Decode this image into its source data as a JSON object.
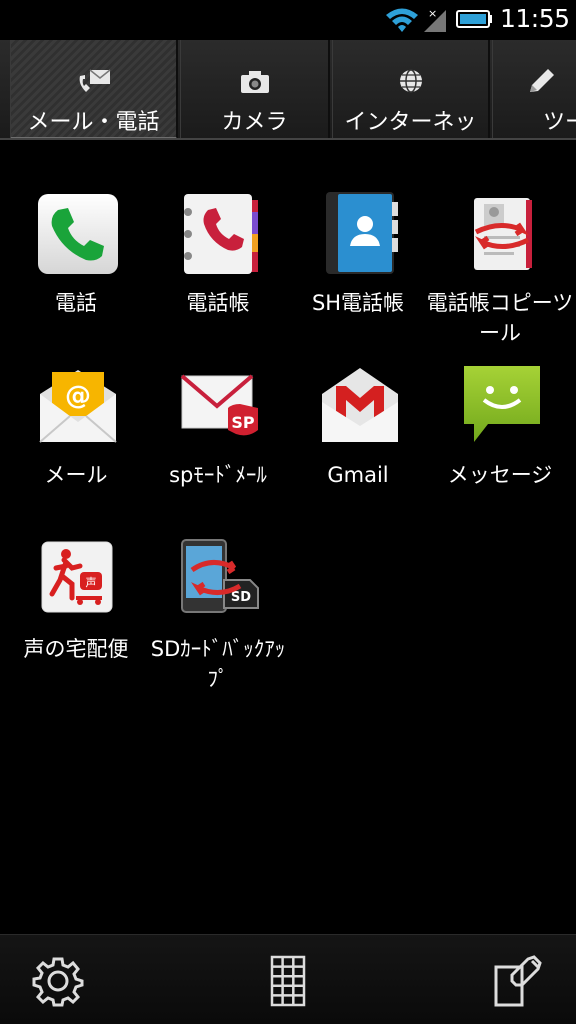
{
  "status": {
    "time": "11:55"
  },
  "tabs": [
    {
      "label": "メール・電話",
      "icon": "mail-phone-icon",
      "active": true
    },
    {
      "label": "カメラ",
      "icon": "camera-icon",
      "active": false
    },
    {
      "label": "インターネッ",
      "icon": "globe-icon",
      "active": false
    },
    {
      "label": "ツー",
      "icon": "pencil-icon",
      "active": false
    }
  ],
  "apps": [
    {
      "label": "電話",
      "icon": "phone-icon"
    },
    {
      "label": "電話帳",
      "icon": "phonebook-icon"
    },
    {
      "label": "SH電話帳",
      "icon": "sh-phonebook-icon"
    },
    {
      "label": "電話帳コピーツール",
      "icon": "phonebook-copy-icon"
    },
    {
      "label": "メール",
      "icon": "mail-icon"
    },
    {
      "label": "spﾓｰﾄﾞﾒｰﾙ",
      "icon": "spmode-mail-icon"
    },
    {
      "label": "Gmail",
      "icon": "gmail-icon"
    },
    {
      "label": "メッセージ",
      "icon": "message-icon"
    },
    {
      "label": "声の宅配便",
      "icon": "voice-delivery-icon"
    },
    {
      "label": "SDｶｰﾄﾞﾊﾞｯｸｱｯﾌﾟ",
      "icon": "sd-backup-icon"
    }
  ],
  "bottom": {
    "settings": "gear-icon",
    "grid": "grid-icon",
    "edit": "edit-icon"
  }
}
